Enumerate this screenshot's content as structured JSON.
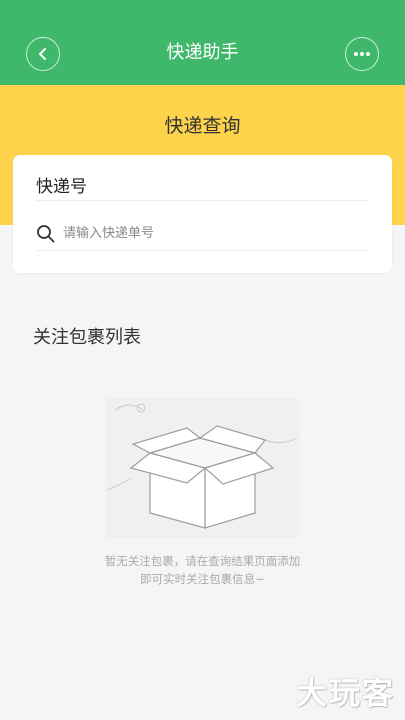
{
  "header": {
    "title": "快递助手",
    "back_icon": "chevron-left-icon",
    "more_icon": "more-dots-icon",
    "color": "#3fb86b"
  },
  "banner": {
    "heading": "快递查询",
    "color": "#fdd34c"
  },
  "query_card": {
    "label": "快递号",
    "search": {
      "icon": "search-icon",
      "placeholder": "请输入快递单号",
      "value": ""
    }
  },
  "watch_list": {
    "title": "关注包裹列表",
    "empty_icon": "empty-box-icon",
    "empty_line1": "暂无关注包裹，请在查询结果页面添加",
    "empty_line2": "即可实时关注包裹信息~"
  },
  "watermark": "大玩客"
}
